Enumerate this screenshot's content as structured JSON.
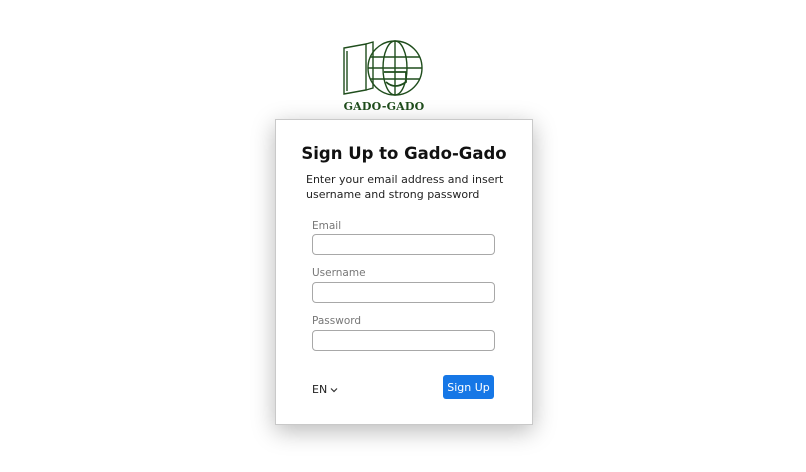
{
  "brand": {
    "name": "GADO-GADO",
    "color": "#1f4d1c"
  },
  "form": {
    "title": "Sign Up to Gado-Gado",
    "subtitle": "Enter your email address and insert username and strong password",
    "fields": [
      {
        "label": "Email",
        "value": "",
        "placeholder": ""
      },
      {
        "label": "Username",
        "value": "",
        "placeholder": ""
      },
      {
        "label": "Password",
        "value": "",
        "placeholder": ""
      }
    ],
    "language": "EN",
    "submit_label": "Sign Up",
    "accent_color": "#1677e6"
  }
}
